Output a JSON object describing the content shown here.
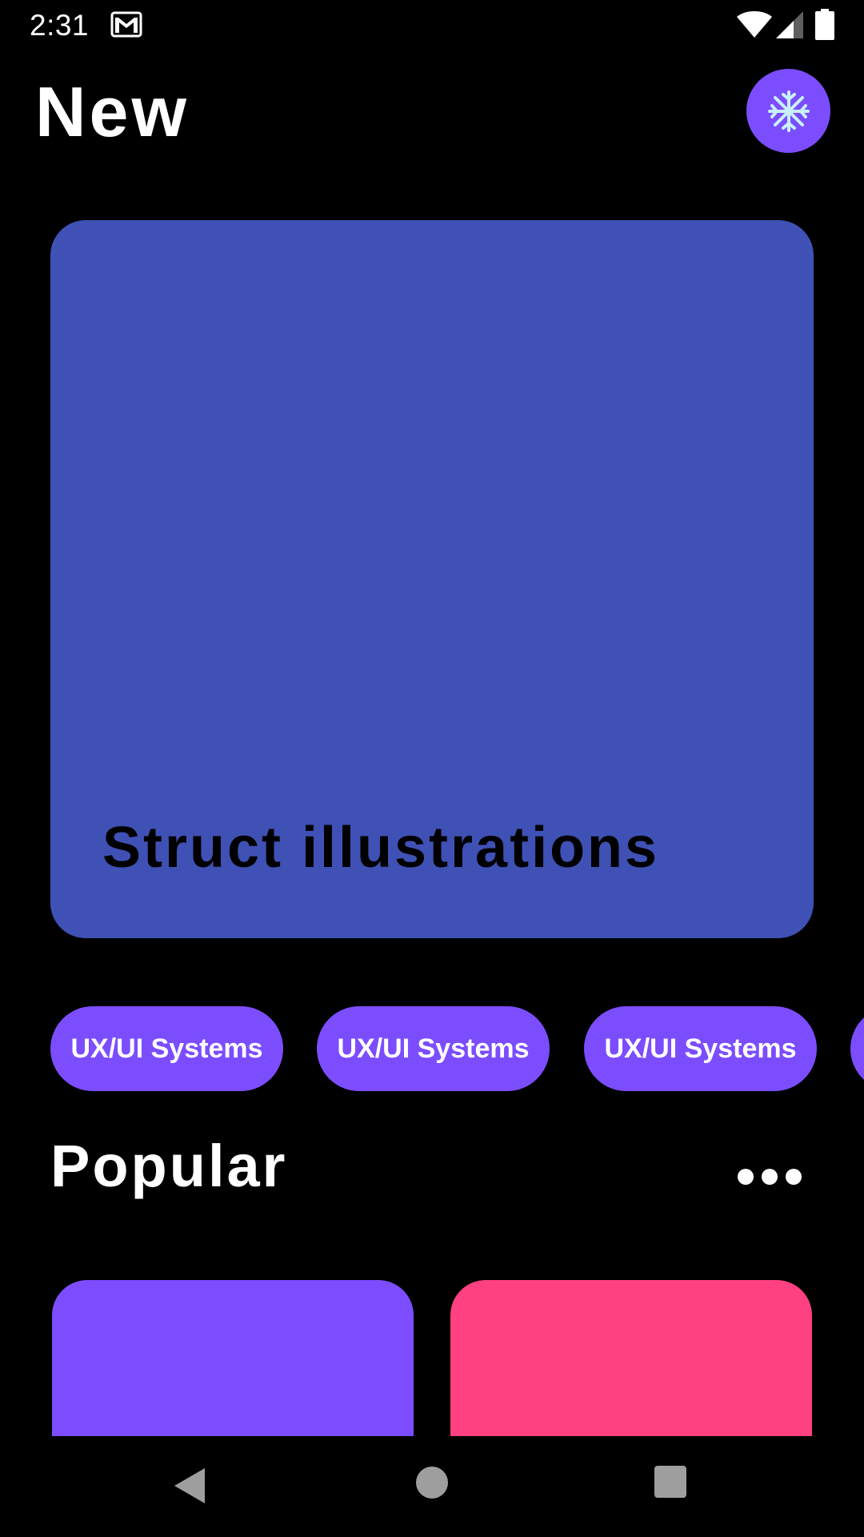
{
  "status_bar": {
    "time": "2:31",
    "icons": [
      "gmail-icon",
      "wifi-icon",
      "signal-icon",
      "battery-icon"
    ]
  },
  "header": {
    "title": "New",
    "action_icon": "snowflake-icon"
  },
  "hero": {
    "title": "Struct illustrations"
  },
  "chips": [
    "UX/UI Systems",
    "UX/UI Systems",
    "UX/UI Systems",
    ""
  ],
  "popular": {
    "title": "Popular",
    "more_icon": "more-horizontal-icon"
  },
  "colors": {
    "background": "#000000",
    "accent": "#7c4dff",
    "hero_card": "#3f51b5",
    "pink_card": "#ff4081",
    "snowflake": "#c8f0ff"
  },
  "nav": {
    "icons": [
      "back-icon",
      "home-icon",
      "recents-icon"
    ]
  }
}
